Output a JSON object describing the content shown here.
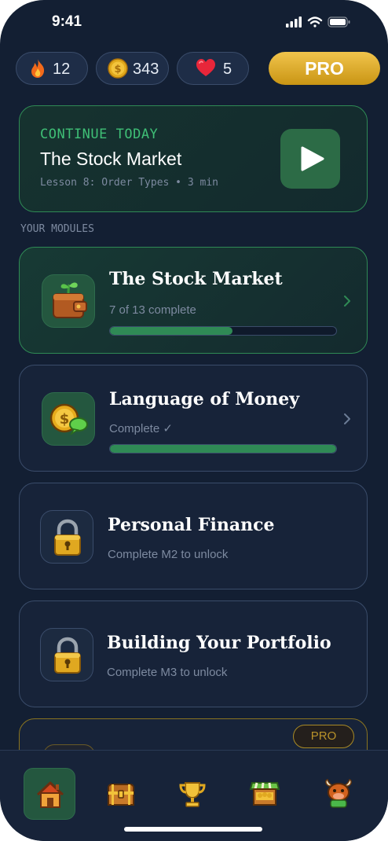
{
  "status_bar": {
    "time": "9:41"
  },
  "stats": {
    "streak": "12",
    "coins": "343",
    "hearts": "5",
    "pro_label": "PRO"
  },
  "continue_card": {
    "kicker": "CONTINUE TODAY",
    "title": "The Stock Market",
    "subtitle": "Lesson 8: Order Types • 3 min"
  },
  "section_label": "YOUR MODULES",
  "modules": [
    {
      "title": "The Stock Market",
      "subtitle": "7 of 13 complete",
      "progress": 0.54,
      "state": "active",
      "icon": "wallet-plant-icon"
    },
    {
      "title": "Language of Money",
      "subtitle": "Complete ✓",
      "progress": 1.0,
      "state": "complete",
      "icon": "coin-chat-icon"
    },
    {
      "title": "Personal Finance",
      "subtitle": "Complete M2 to unlock",
      "state": "locked",
      "icon": "lock-icon"
    },
    {
      "title": "Building Your Portfolio",
      "subtitle": "Complete M3 to unlock",
      "state": "locked",
      "icon": "lock-icon"
    }
  ],
  "pro_module": {
    "badge": "PRO"
  },
  "tabs": [
    {
      "name": "home",
      "icon": "house-icon",
      "selected": true
    },
    {
      "name": "treasure",
      "icon": "treasure-chest-icon"
    },
    {
      "name": "leaderboard",
      "icon": "trophy-icon"
    },
    {
      "name": "shop",
      "icon": "market-stall-icon"
    },
    {
      "name": "profile",
      "icon": "bull-mascot-icon"
    }
  ],
  "colors": {
    "background": "#131f33",
    "accent_green": "#2f8a55",
    "gold": "#e0b02e"
  }
}
